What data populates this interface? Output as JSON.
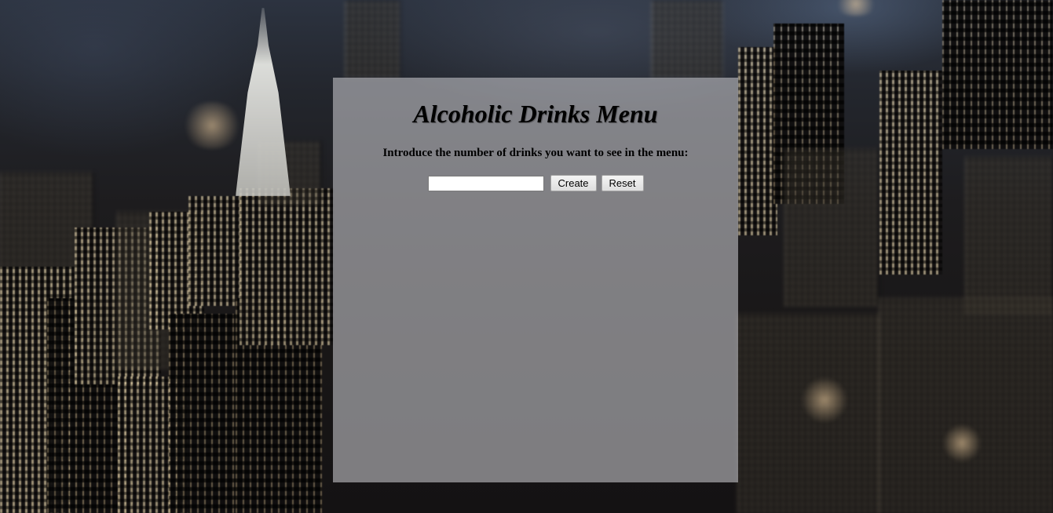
{
  "page": {
    "title": "Alcoholic Drinks Menu",
    "prompt": "Introduce the number of drinks you want to see in the menu:"
  },
  "form": {
    "count_value": "",
    "create_label": "Create",
    "reset_label": "Reset"
  }
}
